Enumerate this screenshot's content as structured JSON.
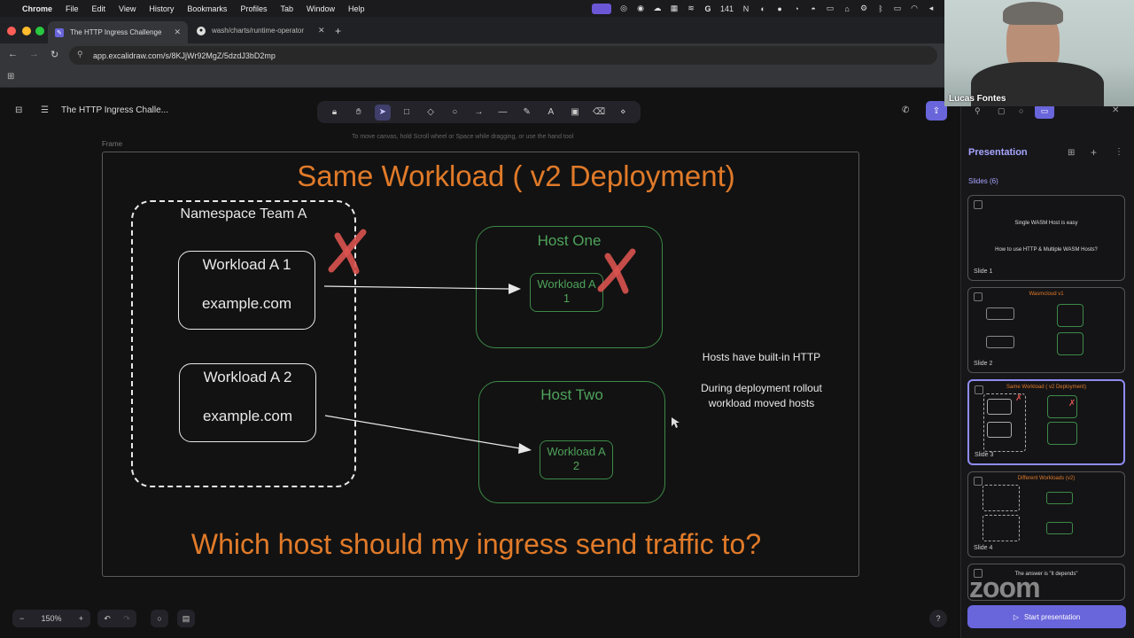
{
  "menubar": {
    "items": [
      "Chrome",
      "File",
      "Edit",
      "View",
      "History",
      "Bookmarks",
      "Profiles",
      "Tab",
      "Window",
      "Help"
    ],
    "tray_count": "141"
  },
  "tabs": [
    {
      "title": "The HTTP Ingress Challenge",
      "active": true
    },
    {
      "title": "wash/charts/runtime-operator",
      "active": false
    }
  ],
  "address": {
    "url": "app.excalidraw.com/s/8KJjWr92MgZ/5dzdJ3bD2mp"
  },
  "app": {
    "doc_title": "The HTTP Ingress Challe...",
    "hint": "To move canvas, hold Scroll wheel or Space while dragging, or use the hand tool",
    "frame_label": "Frame",
    "zoom": "150%"
  },
  "drawing": {
    "title": "Same Workload ( v2 Deployment)",
    "namespace_label": "Namespace Team A",
    "workload_a1": "Workload A 1",
    "domain_1": "example.com",
    "workload_a2": "Workload A 2",
    "domain_2": "example.com",
    "host_one": "Host One",
    "host_one_workload": "Workload A 1",
    "host_two": "Host Two",
    "host_two_workload": "Workload A 2",
    "note_1": "Hosts have built-in HTTP",
    "note_2": "During deployment rollout workload moved hosts",
    "question": "Which host should my ingress send traffic to?"
  },
  "sidebar": {
    "title": "Presentation",
    "slides_count": "Slides (6)",
    "slides": [
      {
        "label": "Slide 1",
        "line1": "Single WASM Host is easy",
        "line2": "How to use HTTP & Multiple WASM Hosts?"
      },
      {
        "label": "Slide 2",
        "title": "Wasmcloud v1"
      },
      {
        "label": "Slide 3",
        "title": "Same Workload ( v2 Deployment)"
      },
      {
        "label": "Slide 4",
        "title": "Different Workloads (v2)"
      },
      {
        "label": "",
        "title": "The answer is \"it depends\""
      }
    ],
    "start_button": "Start presentation"
  },
  "video": {
    "name": "Lucas Fontes",
    "logo": "zoom"
  },
  "colors": {
    "orange": "#e07a29",
    "green": "#4ea35a",
    "accent": "#6965db"
  }
}
